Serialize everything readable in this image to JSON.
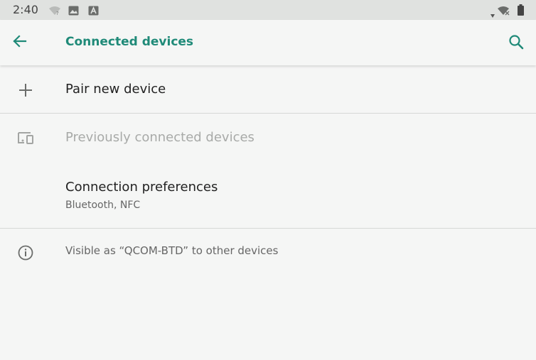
{
  "status_bar": {
    "time": "2:40"
  },
  "app_bar": {
    "title": "Connected devices",
    "accent_color": "#1f8a78"
  },
  "items": {
    "pair": {
      "label": "Pair new device",
      "icon": "plus-icon"
    },
    "previous": {
      "label": "Previously connected devices",
      "icon": "devices-icon"
    },
    "prefs": {
      "label": "Connection preferences",
      "summary": "Bluetooth, NFC"
    }
  },
  "footer": {
    "text": "Visible as “QCOM-BTD” to other devices",
    "icon": "info-icon"
  }
}
